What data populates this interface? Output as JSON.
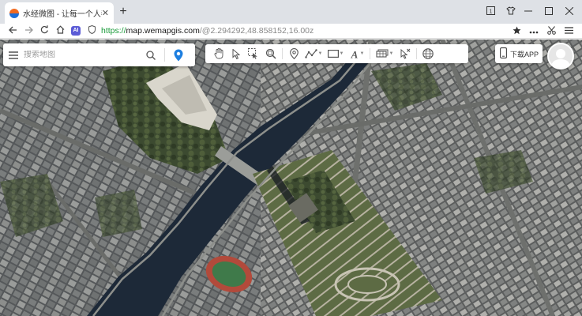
{
  "browser": {
    "tab_title": "水经微图 - 让每一个人都有自",
    "tab_close_glyph": "✕",
    "new_tab_glyph": "+",
    "url_protocol": "https://",
    "url_host": "map.wemapgis.com",
    "url_path": "/@2.294292,48.858152,16.00z",
    "ai_badge": "AI"
  },
  "search": {
    "placeholder": "搜索地图"
  },
  "toolbar": {
    "tools": [
      "pan-hand-icon",
      "select-pointer-icon",
      "box-select-icon",
      "zoom-search-icon",
      "place-marker-icon",
      "draw-polyline-icon",
      "draw-rectangle-icon",
      "text-label-icon",
      "layer-switch-icon",
      "clear-pointer-icon",
      "globe-icon"
    ]
  },
  "download_app": {
    "label": "下载APP"
  },
  "map": {
    "center_lon": 2.294292,
    "center_lat": 48.858152,
    "zoom": 16.0,
    "imagery": "satellite",
    "colors": {
      "river": "#1d2938",
      "vegetation": "#3c4a30",
      "buildings": "#8a8c8a",
      "stadium_track": "#b24a3b",
      "field": "#3f7a4a",
      "accent_pin": "#1e7fe0"
    }
  }
}
